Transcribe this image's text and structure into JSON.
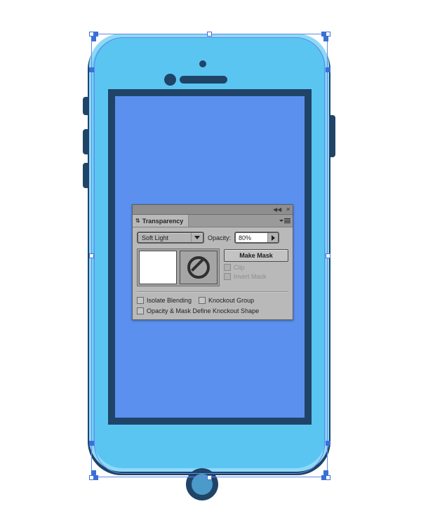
{
  "canvas": {
    "background_color": "#ffffff",
    "artwork_name": "smartphone-illustration"
  },
  "artwork": {
    "colors": {
      "shell_navy": "#1f4468",
      "body_light_blue": "#5bc5f2",
      "rim_highlight": "#8fd9f7",
      "screen_blue": "#5b90ef",
      "home_button_inner": "#4b9ac9",
      "selection_blue": "#5f8ae8",
      "anchor_blue": "#3a6fd8"
    },
    "parts": {
      "shell": "phone-shell",
      "screen": "phone-screen",
      "camera": "front-camera",
      "sensor": "proximity-sensor",
      "speaker": "earpiece-speaker",
      "home_button": "home-button",
      "silent_switch": "silent-switch",
      "volume_up": "volume-up-button",
      "volume_down": "volume-down-button",
      "power": "power-button"
    }
  },
  "panel": {
    "titlebar": {
      "collapse_icon": "◀◀",
      "close_icon": "✕"
    },
    "tab": {
      "diamond_icon": "⇅",
      "label": "Transparency"
    },
    "menu_icon": "panel-menu-icon",
    "blend": {
      "mode": "Soft Light",
      "arrow_icon": "chevron-down-icon"
    },
    "opacity": {
      "label": "Opacity:",
      "value": "80%",
      "arrow_icon": "chevron-right-icon"
    },
    "thumbnails": {
      "art_thumb": "artwork-thumbnail",
      "mask_thumb": "mask-thumbnail",
      "mask_icon": "no-entry-icon"
    },
    "mask": {
      "make_mask_label": "Make Mask",
      "clip_label": "Clip",
      "clip_checked": false,
      "clip_enabled": false,
      "invert_mask_label": "Invert Mask",
      "invert_mask_checked": false,
      "invert_mask_enabled": false
    },
    "options": {
      "isolate_blending_label": "Isolate Blending",
      "isolate_blending_checked": false,
      "knockout_group_label": "Knockout Group",
      "knockout_group_checked": false,
      "opacity_mask_label": "Opacity & Mask Define Knockout Shape",
      "opacity_mask_checked": false
    }
  }
}
